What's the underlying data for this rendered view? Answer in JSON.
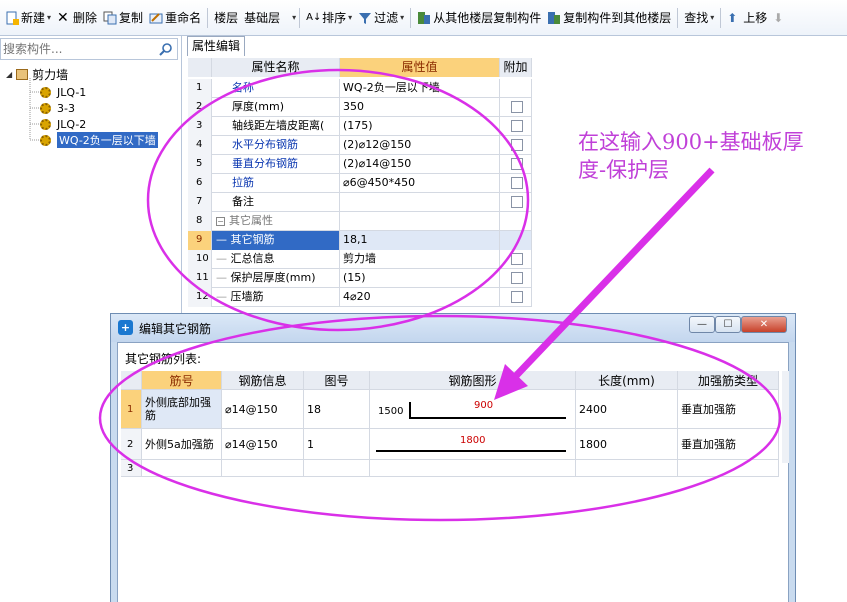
{
  "toolbar": {
    "new_label": "新建",
    "delete_label": "删除",
    "copy_label": "复制",
    "rename_label": "重命名",
    "floor_label": "楼层",
    "floor_value": "基础层",
    "sort_label": "排序",
    "filter_label": "过滤",
    "copy_from_floor_label": "从其他楼层复制构件",
    "copy_to_floor_label": "复制构件到其他楼层",
    "find_label": "查找",
    "move_up_label": "上移"
  },
  "sidebar": {
    "search_placeholder": "搜索构件...",
    "root_label": "剪力墙",
    "items": [
      {
        "label": "JLQ-1"
      },
      {
        "label": "3-3"
      },
      {
        "label": "JLQ-2"
      },
      {
        "label": "WQ-2负一层以下墙"
      }
    ]
  },
  "property_panel": {
    "tab_label": "属性编辑",
    "headers": {
      "name": "属性名称",
      "value": "属性值",
      "extra": "附加"
    },
    "rows": [
      {
        "num": "1",
        "name": "名称",
        "value": "WQ-2负一层以下墙"
      },
      {
        "num": "2",
        "name": "厚度(mm)",
        "value": "350"
      },
      {
        "num": "3",
        "name": "轴线距左墙皮距离(",
        "value": "(175)"
      },
      {
        "num": "4",
        "name": "水平分布钢筋",
        "value": "(2)⌀12@150"
      },
      {
        "num": "5",
        "name": "垂直分布钢筋",
        "value": "(2)⌀14@150"
      },
      {
        "num": "6",
        "name": "拉筋",
        "value": "⌀6@450*450"
      },
      {
        "num": "7",
        "name": "备注",
        "value": ""
      },
      {
        "num": "8",
        "name": "其它属性",
        "value": ""
      },
      {
        "num": "9",
        "name": "其它钢筋",
        "value": "18,1"
      },
      {
        "num": "10",
        "name": "汇总信息",
        "value": "剪力墙"
      },
      {
        "num": "11",
        "name": "保护层厚度(mm)",
        "value": "(15)"
      },
      {
        "num": "12",
        "name": "压墙筋",
        "value": "4⌀20"
      }
    ]
  },
  "annotation": {
    "line1": "在这输入900+基础板厚",
    "line2": "度-保护层"
  },
  "dialog": {
    "title": "编辑其它钢筋",
    "list_label": "其它钢筋列表:",
    "headers": [
      "筋号",
      "钢筋信息",
      "图号",
      "钢筋图形",
      "长度(mm)",
      "加强筋类型"
    ],
    "rows": [
      {
        "idx": "1",
        "no": "外侧底部加强筋",
        "info": "⌀14@150",
        "fig": "18",
        "shape_left": "1500",
        "shape_mid": "900",
        "length": "2400",
        "type": "垂直加强筋"
      },
      {
        "idx": "2",
        "no": "外侧5a加强筋",
        "info": "⌀14@150",
        "fig": "1",
        "shape_left": "",
        "shape_mid": "1800",
        "length": "1800",
        "type": "垂直加强筋"
      },
      {
        "idx": "3",
        "no": "",
        "info": "",
        "fig": "",
        "shape_left": "",
        "shape_mid": "",
        "length": "",
        "type": ""
      }
    ]
  },
  "colors": {
    "annotation": "#c040d8",
    "highlight_orange": "#fbd27c",
    "selection_blue": "#316ac5"
  }
}
